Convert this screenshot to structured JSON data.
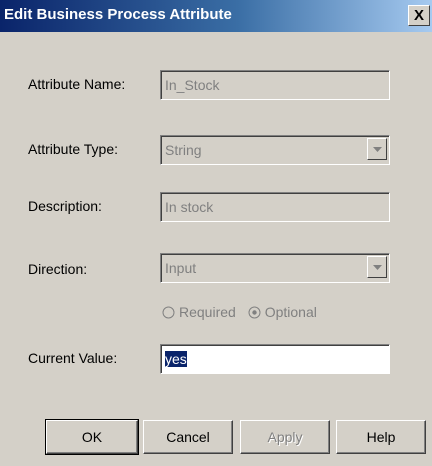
{
  "window": {
    "title": "Edit Business Process Attribute",
    "close_label": "X"
  },
  "fields": {
    "name": {
      "label": "Attribute Name:",
      "value": "In_Stock"
    },
    "type": {
      "label": "Attribute Type:",
      "value": "String"
    },
    "description": {
      "label": "Description:",
      "value": "In stock"
    },
    "direction": {
      "label": "Direction:",
      "value": "Input"
    },
    "current_value": {
      "label": "Current Value:",
      "value": "yes"
    }
  },
  "radios": {
    "required_label": "Required",
    "optional_label": "Optional",
    "selected": "Optional"
  },
  "buttons": {
    "ok": "OK",
    "cancel": "Cancel",
    "apply": "Apply",
    "help": "Help"
  },
  "colors": {
    "titlebar": "#0a246a",
    "dialog_bg": "#d4d0c8",
    "selection": "#0a246a"
  }
}
